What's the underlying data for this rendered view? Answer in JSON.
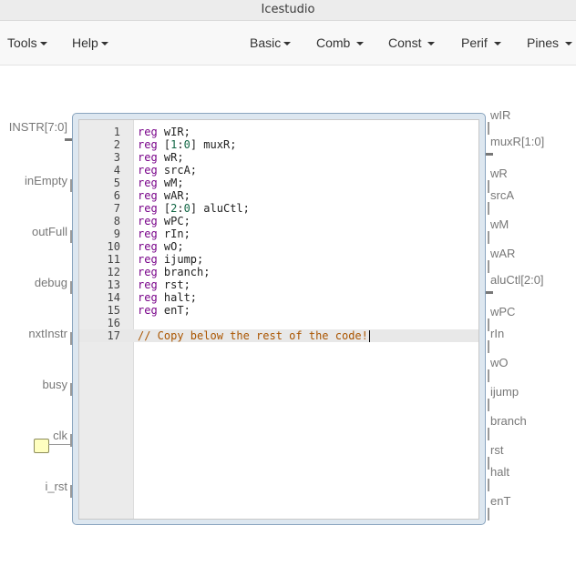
{
  "window": {
    "title": "Icestudio"
  },
  "menubar": {
    "left": [
      {
        "label": "Tools"
      },
      {
        "label": "Help"
      }
    ],
    "right": [
      {
        "label": "Basic"
      },
      {
        "label": "Comb"
      },
      {
        "label": "Const"
      },
      {
        "label": "Perif"
      },
      {
        "label": "Pines"
      }
    ]
  },
  "block": {
    "inputs": [
      "INSTR[7:0]",
      "inEmpty",
      "outFull",
      "debug",
      "nxtInstr",
      "busy",
      "clk",
      "i_rst"
    ],
    "outputs": [
      "wIR",
      "muxR[1:0]",
      "wR",
      "srcA",
      "wM",
      "wAR",
      "aluCtl[2:0]",
      "wPC",
      "rIn",
      "wO",
      "ijump",
      "branch",
      "rst",
      "halt",
      "enT"
    ]
  },
  "editor": {
    "lines": [
      {
        "num": "1",
        "kw": "reg",
        "rest": " wIR;"
      },
      {
        "num": "2",
        "kw": "reg",
        "pre": " [",
        "n1": "1",
        "mid": ":",
        "n2": "0",
        "rest": "] muxR;"
      },
      {
        "num": "3",
        "kw": "reg",
        "rest": " wR;"
      },
      {
        "num": "4",
        "kw": "reg",
        "rest": " srcA;"
      },
      {
        "num": "5",
        "kw": "reg",
        "rest": " wM;"
      },
      {
        "num": "6",
        "kw": "reg",
        "rest": " wAR;"
      },
      {
        "num": "7",
        "kw": "reg",
        "pre": " [",
        "n1": "2",
        "mid": ":",
        "n2": "0",
        "rest": "] aluCtl;"
      },
      {
        "num": "8",
        "kw": "reg",
        "rest": " wPC;"
      },
      {
        "num": "9",
        "kw": "reg",
        "rest": " rIn;"
      },
      {
        "num": "10",
        "kw": "reg",
        "rest": " wO;"
      },
      {
        "num": "11",
        "kw": "reg",
        "rest": " ijump;"
      },
      {
        "num": "12",
        "kw": "reg",
        "rest": " branch;"
      },
      {
        "num": "13",
        "kw": "reg",
        "rest": " rst;"
      },
      {
        "num": "14",
        "kw": "reg",
        "rest": " halt;"
      },
      {
        "num": "15",
        "kw": "reg",
        "rest": " enT;"
      },
      {
        "num": "16"
      },
      {
        "num": "17",
        "comment": "// Copy below the rest of the code!",
        "active": true
      }
    ]
  }
}
